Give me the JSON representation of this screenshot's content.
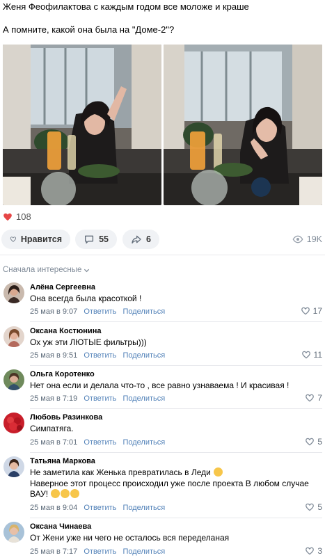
{
  "post": {
    "line1": "Женя Феофилактова с каждым годом все моложе и краше",
    "line2": "А помните, какой она была на \"Доме-2\"?"
  },
  "reactions": {
    "likes_count": "108",
    "like_button_label": "Нравится",
    "comments_count": "55",
    "shares_count": "6",
    "views_count": "19K"
  },
  "sort_label": "Сначала интересные",
  "comments": [
    {
      "name": "Алёна Сергеевна",
      "text": "Она всегда была красоткой !",
      "date": "25 мая в 9:07",
      "reply": "Ответить",
      "share": "Поделиться",
      "likes": "17"
    },
    {
      "name": "Оксана Костюнина",
      "text": "Ох уж эти ЛЮТЫЕ фильтры)))",
      "date": "25 мая в 9:51",
      "reply": "Ответить",
      "share": "Поделиться",
      "likes": "11"
    },
    {
      "name": "Ольга Коротенко",
      "text": "Нет она если и делала что-то , все равно узнаваема ! И красивая !",
      "date": "25 мая в 7:19",
      "reply": "Ответить",
      "share": "Поделиться",
      "likes": "7"
    },
    {
      "name": "Любовь Разинкова",
      "text": "Симпатяга.",
      "date": "25 мая в 7:01",
      "reply": "Ответить",
      "share": "Поделиться",
      "likes": "5"
    },
    {
      "name": "Татьяна Маркова",
      "text": "Не заметила как Женька превратилась в Леди",
      "text2": "Наверное этот процесс происходил уже после проекта В любом случае ВАУ!",
      "date": "25 мая в 9:04",
      "reply": "Ответить",
      "share": "Поделиться",
      "likes": "5"
    },
    {
      "name": "Оксана Чинаева",
      "text": "От Жени уже ни чего не осталось вся переделаная",
      "date": "25 мая в 7:17",
      "reply": "Ответить",
      "share": "Поделиться",
      "likes": "3"
    }
  ],
  "colors": {
    "accent": "#5181b8",
    "meta": "#818c99",
    "like_red": "#e64646",
    "pill_bg": "#f0f2f5"
  }
}
